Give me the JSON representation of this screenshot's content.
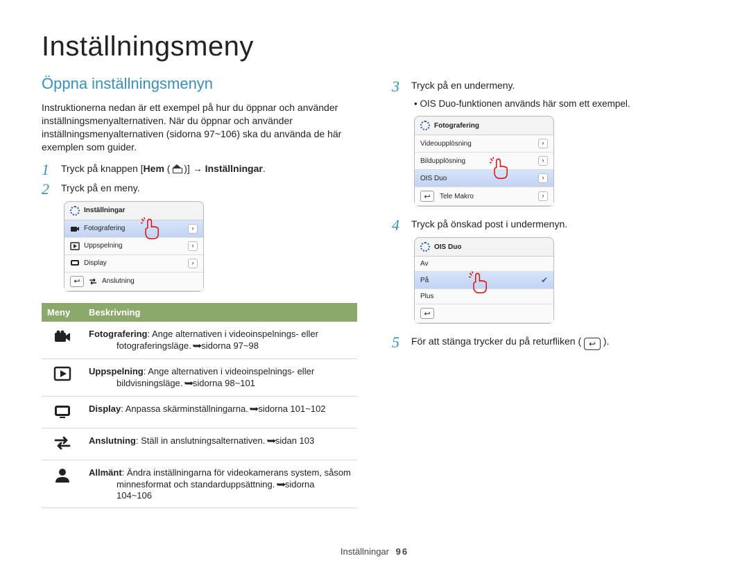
{
  "page_title": "Inställningsmeny",
  "section_title": "Öppna inställningsmenyn",
  "intro": "Instruktionerna nedan är ett exempel på hur du öppnar och använder inställningsmenyalternativen. När du öppnar och använder inställningsmenyalternativen (sidorna 97~106) ska du använda de här exemplen som guider.",
  "steps": {
    "s1_num": "1",
    "s1_a": "Tryck på knappen [",
    "s1_b": "Hem",
    "s1_c": " ( ",
    "s1_d": " )] → ",
    "s1_e": "Inställningar",
    "s1_f": ".",
    "s2_num": "2",
    "s2_txt": "Tryck på en meny.",
    "s3_num": "3",
    "s3_txt": "Tryck på en undermeny.",
    "s3_bullet": "OIS Duo-funktionen används här som ett exempel.",
    "s4_num": "4",
    "s4_txt": "Tryck på önskad post i undermenyn.",
    "s5_num": "5",
    "s5_a": "För att stänga trycker du på returfliken ( ",
    "s5_b": " )."
  },
  "panel1": {
    "title": "Inställningar",
    "items": [
      "Fotografering",
      "Uppspelning",
      "Display",
      "Anslutning"
    ]
  },
  "panel2": {
    "title": "Fotografering",
    "items": [
      "Videoupplösning",
      "Bildupplösning",
      "OIS Duo",
      "Tele Makro"
    ]
  },
  "panel3": {
    "title": "OIS Duo",
    "items": [
      "Av",
      "På",
      "Plus"
    ]
  },
  "table": {
    "h1": "Meny",
    "h2": "Beskrivning",
    "rows": [
      {
        "name": "Fotografering",
        "rest": ": Ange alternativen i videoinspelnings- eller",
        "sub": "fotograferingsläge. ",
        "ref": "sidorna 97~98",
        "icon": "camera"
      },
      {
        "name": "Uppspelning",
        "rest": ": Ange alternativen i videoinspelnings- eller",
        "sub": "bildvisningsläge. ",
        "ref": "sidorna 98~101",
        "icon": "play"
      },
      {
        "name": "Display",
        "rest": ": Anpassa skärminställningarna. ",
        "sub": "",
        "ref": "sidorna 101~102",
        "icon": "display"
      },
      {
        "name": "Anslutning",
        "rest": ": Ställ in anslutningsalternativen. ",
        "sub": "",
        "ref": "sidan 103",
        "icon": "swap"
      },
      {
        "name": "Allmänt",
        "rest": ": Ändra inställningarna för videokamerans system, såsom",
        "sub": "minnesformat och standarduppsättning.",
        "ref": "sidorna 104~106",
        "icon": "user"
      }
    ]
  },
  "footer": {
    "label": "Inställningar",
    "page": "96"
  }
}
